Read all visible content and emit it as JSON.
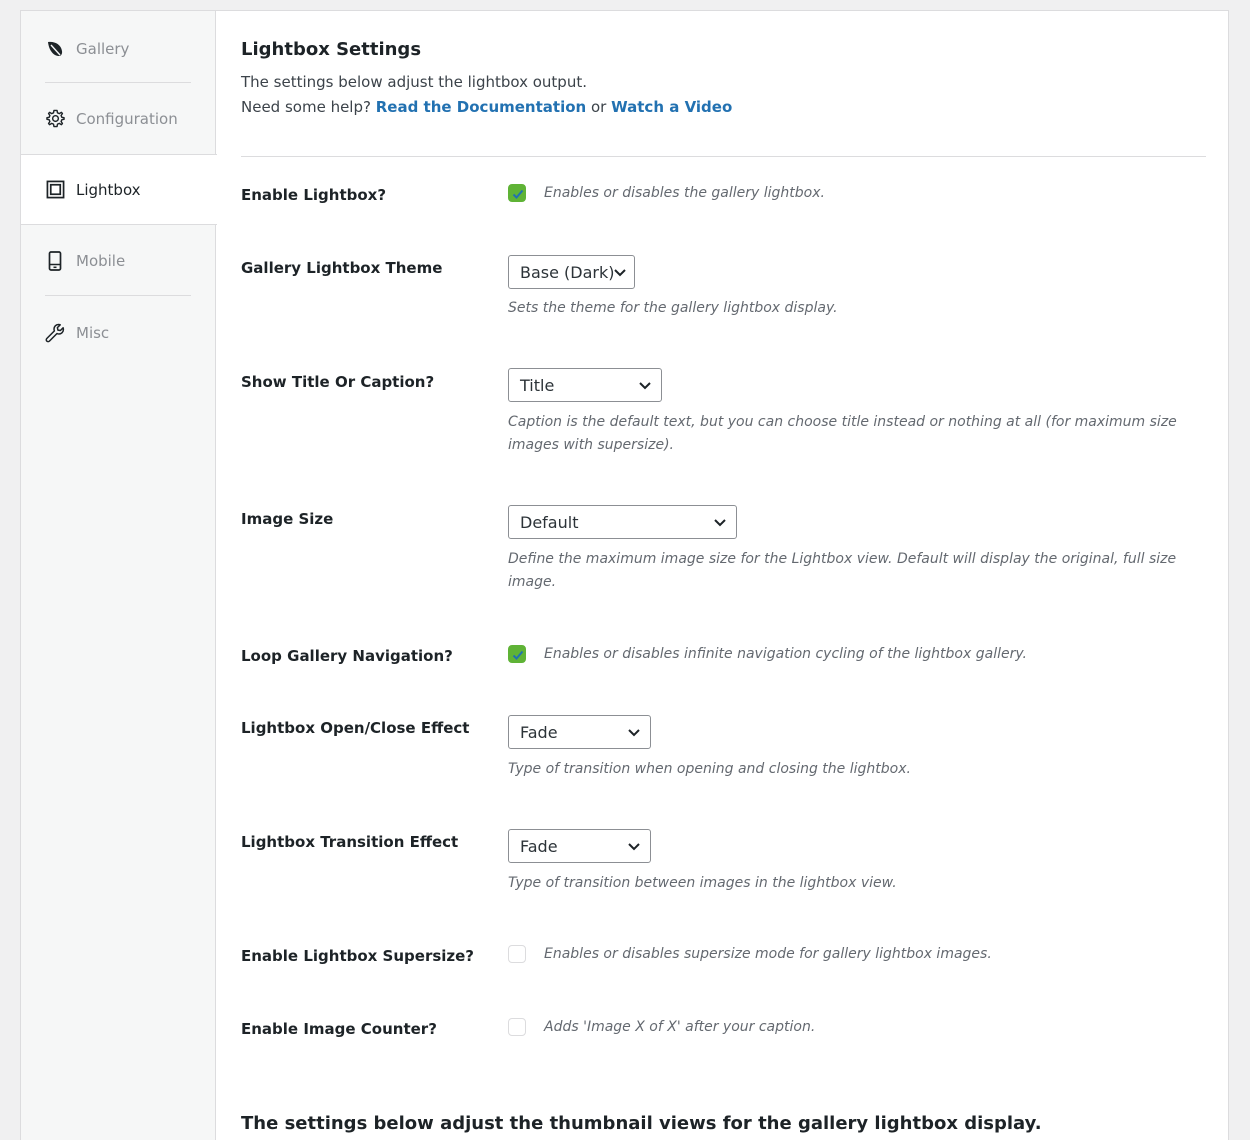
{
  "sidebar": {
    "items": [
      {
        "label": "Gallery",
        "icon": "leaf-icon"
      },
      {
        "label": "Configuration",
        "icon": "gear-icon"
      },
      {
        "label": "Lightbox",
        "icon": "lightbox-icon",
        "active": true
      },
      {
        "label": "Mobile",
        "icon": "mobile-icon"
      },
      {
        "label": "Misc",
        "icon": "wrench-icon"
      }
    ]
  },
  "header": {
    "title": "Lightbox Settings",
    "description": "The settings below adjust the lightbox output.",
    "help_prefix": "Need some help?",
    "doc_link": "Read the Documentation",
    "or_text": "or",
    "video_link": "Watch a Video"
  },
  "settings": {
    "enable_lightbox": {
      "label": "Enable Lightbox?",
      "checked": true,
      "help": "Enables or disables the gallery lightbox."
    },
    "theme": {
      "label": "Gallery Lightbox Theme",
      "value": "Base (Dark)",
      "help": "Sets the theme for the gallery lightbox display."
    },
    "title_caption": {
      "label": "Show Title Or Caption?",
      "value": "Title",
      "help": "Caption is the default text, but you can choose title instead or nothing at all (for maximum size images with supersize)."
    },
    "image_size": {
      "label": "Image Size",
      "value": "Default",
      "help": "Define the maximum image size for the Lightbox view. Default will display the original, full size image."
    },
    "loop": {
      "label": "Loop Gallery Navigation?",
      "checked": true,
      "help": "Enables or disables infinite navigation cycling of the lightbox gallery."
    },
    "open_close_effect": {
      "label": "Lightbox Open/Close Effect",
      "value": "Fade",
      "help": "Type of transition when opening and closing the lightbox."
    },
    "transition_effect": {
      "label": "Lightbox Transition Effect",
      "value": "Fade",
      "help": "Type of transition between images in the lightbox view."
    },
    "supersize": {
      "label": "Enable Lightbox Supersize?",
      "checked": false,
      "help": "Enables or disables supersize mode for gallery lightbox images."
    },
    "image_counter": {
      "label": "Enable Image Counter?",
      "checked": false,
      "help": "Adds 'Image X of X' after your caption."
    }
  },
  "thumbnails_heading": "The settings below adjust the thumbnail views for the gallery lightbox display.",
  "colors": {
    "accent_link": "#2271b1",
    "checkbox_on": "#5fb336",
    "sidebar_bg": "#f6f7f7"
  }
}
